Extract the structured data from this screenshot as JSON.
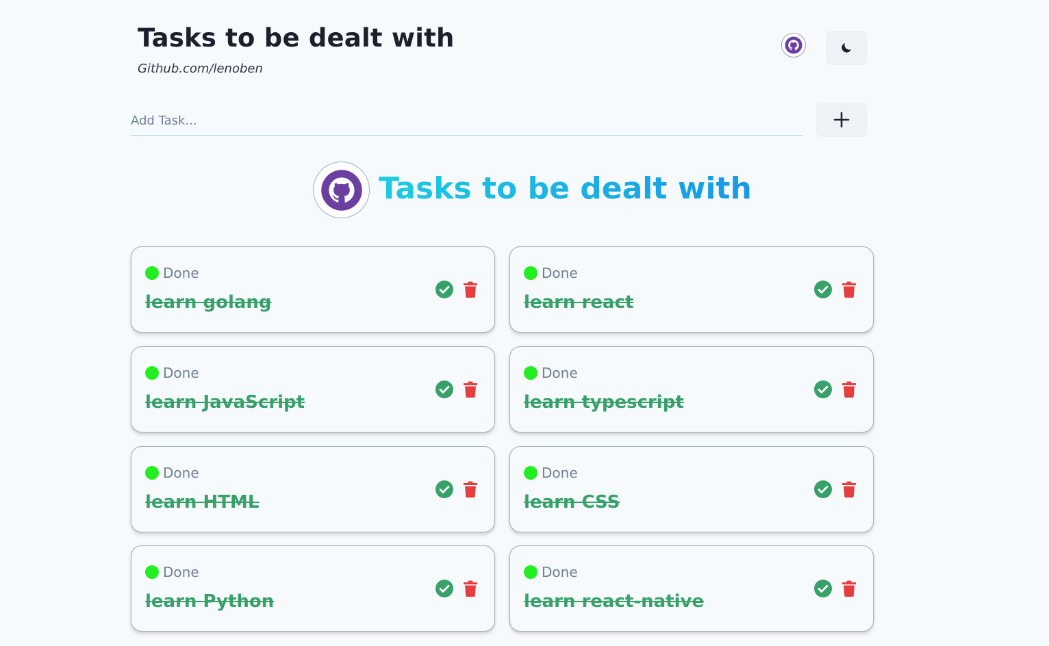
{
  "header": {
    "title": "Tasks to be dealt with",
    "subtitle": "Github.com/lenoben"
  },
  "icons": {
    "github": "github-icon",
    "theme": "moon-icon",
    "add": "plus-icon",
    "complete": "check-circle-icon",
    "delete": "trash-icon"
  },
  "input": {
    "placeholder": "Add Task...",
    "value": ""
  },
  "hero": {
    "title": "Tasks to be dealt with"
  },
  "colors": {
    "background": "#f7fafc",
    "github_purple": "#6b3fa0",
    "done_dot": "#22ee22",
    "task_text": "#38a169",
    "check": "#38a169",
    "trash": "#e53e3e",
    "hero_gradient_start": "#1ecbe1",
    "hero_gradient_end": "#1799e6"
  },
  "tasks": [
    {
      "status": "Done",
      "text": "learn golang"
    },
    {
      "status": "Done",
      "text": "learn react"
    },
    {
      "status": "Done",
      "text": "learn JavaScript"
    },
    {
      "status": "Done",
      "text": "learn typescript"
    },
    {
      "status": "Done",
      "text": "learn HTML"
    },
    {
      "status": "Done",
      "text": "learn CSS"
    },
    {
      "status": "Done",
      "text": "learn Python"
    },
    {
      "status": "Done",
      "text": "learn react-native"
    }
  ]
}
